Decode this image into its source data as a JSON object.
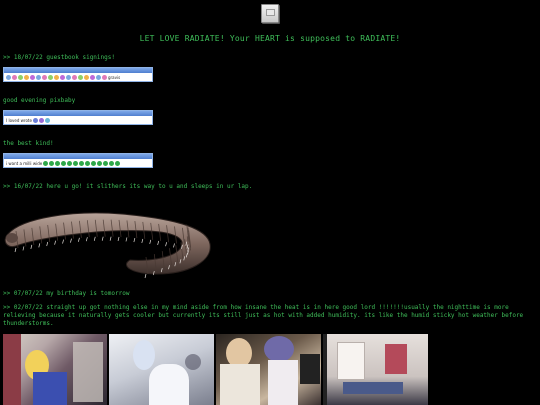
{
  "headline": "LET LOVE RADIATE! Your HEART is supposed to RADIATE!",
  "entries": {
    "e1": ">> 18/07/22 guestbook signings!",
    "e2": "good evening pixbaby",
    "e3": "the best kind!",
    "e4": ">> 16/07/22 here u go! it slithers its way to u and sleeps in ur lap.",
    "e5": ">> 07/07/22 my birthday is tomorrow",
    "e6": ">> 02/07/22 straight up got nothing else in my mind aside from how insane the heat is in here good lord !!!!!!!usually the nighttime is more relieving because it naturally gets cooler but currently its still just as hot with added humidity. its like the humid sticky hot weather before thunderstorms."
  },
  "guestbook": [
    {
      "header": "",
      "text": "gravis",
      "emoji_count": 17,
      "colors": [
        "#7aa7e0",
        "#e07ab8",
        "#8ed06a",
        "#f0b24a",
        "#c06ad8"
      ]
    },
    {
      "header": "",
      "text": "I loved wrote",
      "emoji_count": 3,
      "colors": [
        "#6a7fd8",
        "#9a6ad8",
        "#6ab8d8"
      ]
    },
    {
      "header": "",
      "text": "i want a milli wide",
      "emoji_count": 13,
      "colors": [
        "#2ea84a"
      ]
    }
  ],
  "icons": {
    "top": "window-icon"
  }
}
